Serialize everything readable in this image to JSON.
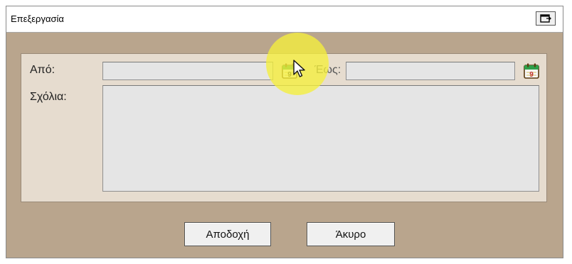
{
  "window": {
    "title": "Επεξεργασία"
  },
  "form": {
    "from_label": "Από:",
    "from_value": "",
    "to_label": "Έως:",
    "to_value": "",
    "comments_label": "Σχόλια:",
    "comments_value": ""
  },
  "buttons": {
    "accept_label": "Αποδοχή",
    "cancel_label": "Άκυρο"
  },
  "icons": {
    "restore": "window-restore-icon",
    "calendar": "calendar-icon",
    "calendar_day": "9"
  },
  "colors": {
    "window_bg": "#b9a58d",
    "panel_bg": "#e6dccf",
    "field_bg": "#e5e5e5",
    "highlight": "#f5f03c"
  }
}
